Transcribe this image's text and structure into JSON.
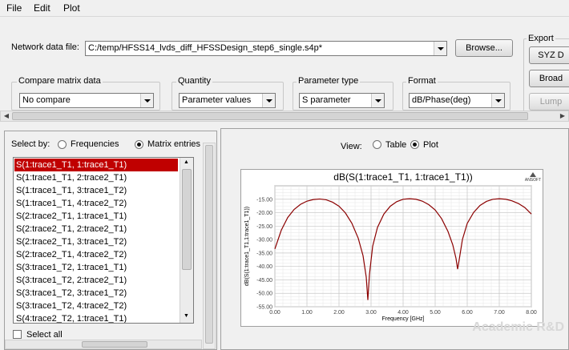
{
  "menu": [
    "File",
    "Edit",
    "Plot"
  ],
  "network": {
    "label": "Network data file:",
    "value": "C:/temp/HFSS14_lvds_diff_HFSSDesign_step6_single.s4p*",
    "browse": "Browse..."
  },
  "export": {
    "title": "Export",
    "buttons": [
      "SYZ D",
      "Broad",
      "Lump"
    ]
  },
  "compare": {
    "title": "Compare matrix data",
    "value": "No compare"
  },
  "quantity": {
    "title": "Quantity",
    "value": "Parameter values"
  },
  "param_type": {
    "title": "Parameter type",
    "value": "S parameter"
  },
  "format": {
    "title": "Format",
    "value": "dB/Phase(deg)"
  },
  "select_by": {
    "label": "Select by:",
    "options": [
      "Frequencies",
      "Matrix entries"
    ],
    "selected": "Matrix entries"
  },
  "entries": [
    "S(1:trace1_T1, 1:trace1_T1)",
    "S(1:trace1_T1, 2:trace2_T1)",
    "S(1:trace1_T1, 3:trace1_T2)",
    "S(1:trace1_T1, 4:trace2_T2)",
    "S(2:trace2_T1, 1:trace1_T1)",
    "S(2:trace2_T1, 2:trace2_T1)",
    "S(2:trace2_T1, 3:trace1_T2)",
    "S(2:trace2_T1, 4:trace2_T2)",
    "S(3:trace1_T2, 1:trace1_T1)",
    "S(3:trace1_T2, 2:trace2_T1)",
    "S(3:trace1_T2, 3:trace1_T2)",
    "S(3:trace1_T2, 4:trace2_T2)",
    "S(4:trace2_T2, 1:trace1_T1)"
  ],
  "selected_entry": "S(1:trace1_T1, 1:trace1_T1)",
  "select_all": "Select all",
  "view": {
    "label": "View:",
    "options": [
      "Table",
      "Plot"
    ],
    "selected": "Plot"
  },
  "logo": "ANSOFT",
  "watermark": "Academic R&D",
  "colors": {
    "trace": "#8b0000",
    "selection": "#c00000"
  },
  "chart_data": {
    "type": "line",
    "title": "dB(S(1:trace1_T1, 1:trace1_T1))",
    "xlabel": "Frequency [GHz]",
    "ylabel": "dB(S(1:trace1_T1,1:trace1_T1))",
    "xlim": [
      0,
      8
    ],
    "ylim": [
      -55,
      -10
    ],
    "xticks": [
      "0.00",
      "1.00",
      "2.00",
      "3.00",
      "4.00",
      "5.00",
      "6.00",
      "7.00",
      "8.00"
    ],
    "yticks": [
      "-15.00",
      "-20.00",
      "-25.00",
      "-30.00",
      "-35.00",
      "-40.00",
      "-45.00",
      "-50.00",
      "-55.00"
    ],
    "grid": true,
    "series": [
      {
        "x": [
          0.0,
          0.2,
          0.4,
          0.6,
          0.8,
          1.0,
          1.2,
          1.4,
          1.6,
          1.8,
          2.0,
          2.2,
          2.4,
          2.6,
          2.75,
          2.85,
          2.9,
          2.95,
          3.05,
          3.2,
          3.4,
          3.6,
          3.8,
          4.0,
          4.2,
          4.4,
          4.6,
          4.8,
          5.0,
          5.2,
          5.4,
          5.55,
          5.65,
          5.7,
          5.75,
          5.85,
          6.0,
          6.2,
          6.4,
          6.6,
          6.8,
          7.0,
          7.2,
          7.4,
          7.6,
          7.8,
          8.0
        ],
        "y": [
          -33.5,
          -26.5,
          -21.8,
          -18.8,
          -16.9,
          -15.7,
          -15.1,
          -14.9,
          -15.2,
          -16.1,
          -17.6,
          -20.1,
          -23.9,
          -29.5,
          -36.0,
          -44.0,
          -52.5,
          -43.0,
          -32.5,
          -25.5,
          -20.5,
          -17.6,
          -15.9,
          -15.0,
          -14.8,
          -15.0,
          -15.7,
          -17.0,
          -19.0,
          -22.2,
          -27.0,
          -32.0,
          -37.0,
          -41.0,
          -37.5,
          -30.0,
          -24.0,
          -19.9,
          -17.3,
          -15.8,
          -15.0,
          -14.8,
          -15.0,
          -15.6,
          -16.6,
          -18.1,
          -20.5
        ]
      }
    ]
  }
}
